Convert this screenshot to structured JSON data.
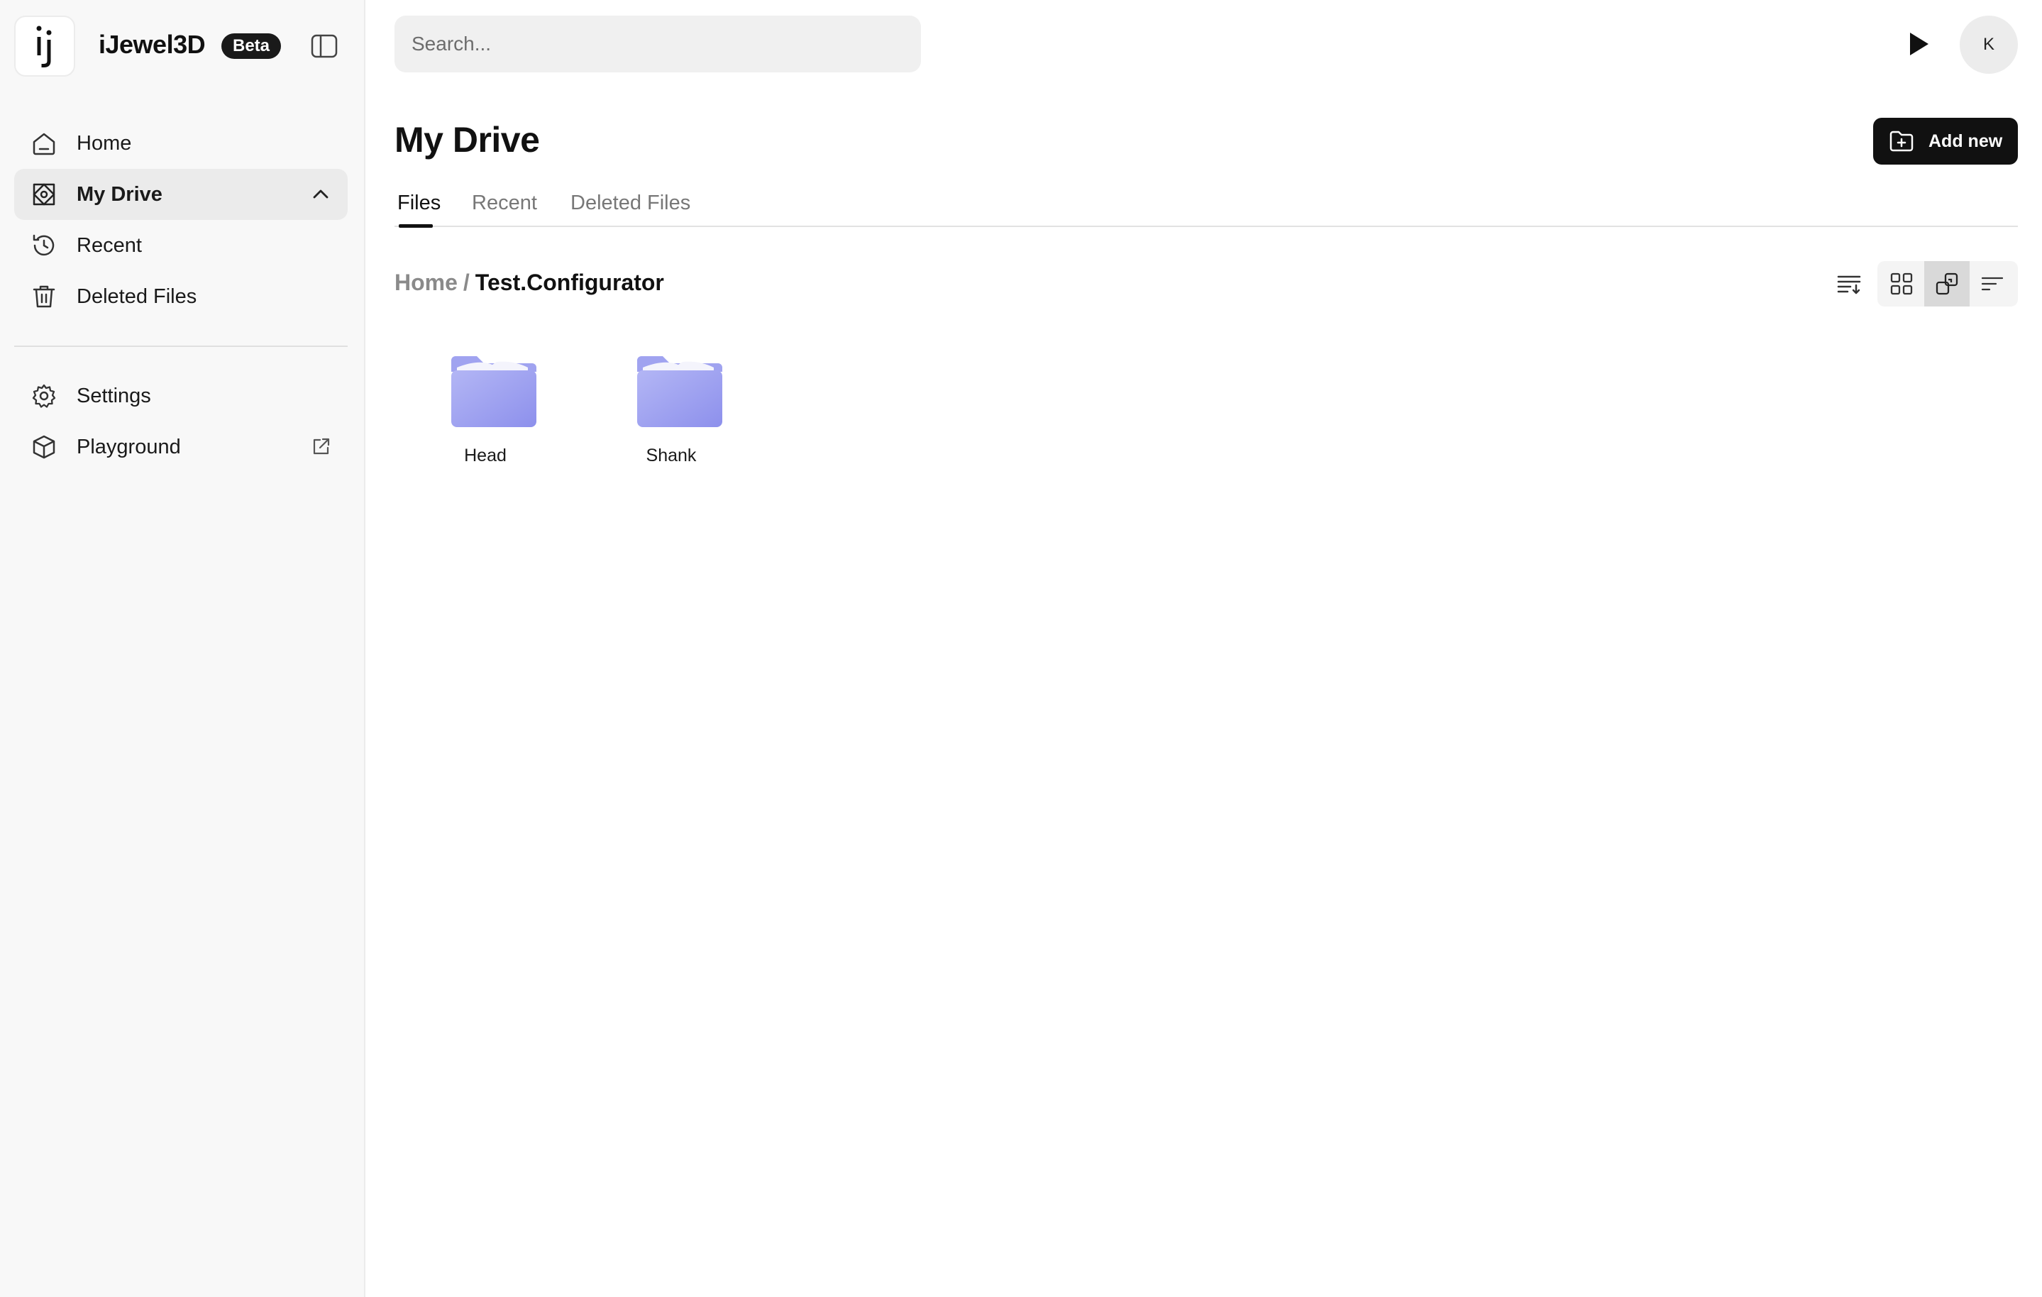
{
  "brand": {
    "name": "iJewel3D",
    "badge": "Beta",
    "logo_text": "ij"
  },
  "sidebar": {
    "items": [
      {
        "label": "Home",
        "icon": "home-icon"
      },
      {
        "label": "My Drive",
        "icon": "drive-icon",
        "active": true,
        "expanded": true
      },
      {
        "label": "Recent",
        "icon": "history-icon"
      },
      {
        "label": "Deleted Files",
        "icon": "trash-icon"
      }
    ],
    "bottom_items": [
      {
        "label": "Settings",
        "icon": "gear-icon"
      },
      {
        "label": "Playground",
        "icon": "cube-icon",
        "trailing_icon": "external-link-icon"
      }
    ]
  },
  "search": {
    "placeholder": "Search..."
  },
  "user": {
    "avatar_initial": "K"
  },
  "page": {
    "title": "My Drive",
    "add_button": "Add new"
  },
  "tabs": [
    {
      "label": "Files",
      "active": true
    },
    {
      "label": "Recent"
    },
    {
      "label": "Deleted Files"
    }
  ],
  "breadcrumb": {
    "home": "Home",
    "separator": "/",
    "current": "Test.Configurator"
  },
  "view_controls": {
    "selected": "cluster-view",
    "icons": [
      "sort-order-icon",
      "grid-view-icon",
      "cluster-view-icon",
      "filter-lines-icon"
    ]
  },
  "folders": [
    {
      "name": "Head"
    },
    {
      "name": "Shank"
    }
  ],
  "colors": {
    "accent": "#111111",
    "folder": "#a5a8f2",
    "sidebar_bg": "#f8f8f8",
    "active_nav_bg": "#ebebeb"
  }
}
